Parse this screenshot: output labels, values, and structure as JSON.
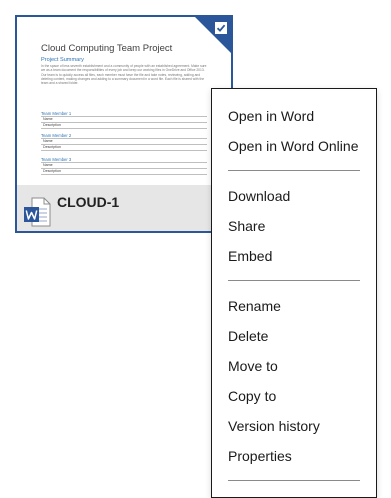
{
  "file": {
    "name": "CLOUD-1",
    "selected": true,
    "icon": "word-document-icon",
    "preview": {
      "title": "Cloud Computing Team Project",
      "section_heading": "Project Summary",
      "body": "In the space of less seventh establishment and a community of people with an established agreement. Make sure we as a team document the responsibilities of every job and keep our working files in OneDrive and Office 2013. Our team is to quickly access all files, each member must have the file and take notes, reviewing, adding and deleting content, making changes and adding to a summary document in a word file. Each file is shared with the team and a shared folder.",
      "members": [
        {
          "title": "Team Member 1",
          "name_label": "Name",
          "description_label": "Description"
        },
        {
          "title": "Team Member 2",
          "name_label": "Name",
          "description_label": "Description"
        },
        {
          "title": "Team Member 3",
          "name_label": "Name",
          "description_label": "Description"
        }
      ]
    }
  },
  "colors": {
    "accent": "#2b579a",
    "footer_bg": "#e6e6e6",
    "doc_heading": "#2e74b5"
  },
  "menu": {
    "groups": [
      [
        {
          "label": "Open in Word"
        },
        {
          "label": "Open in Word Online"
        }
      ],
      [
        {
          "label": "Download"
        },
        {
          "label": "Share"
        },
        {
          "label": "Embed"
        }
      ],
      [
        {
          "label": "Rename"
        },
        {
          "label": "Delete"
        },
        {
          "label": "Move to"
        },
        {
          "label": "Copy to"
        },
        {
          "label": "Version history"
        },
        {
          "label": "Properties"
        }
      ]
    ]
  }
}
